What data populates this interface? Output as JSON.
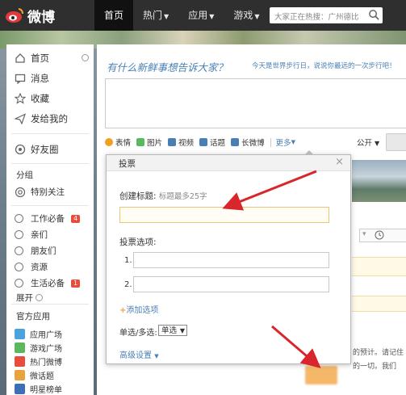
{
  "topbar": {
    "logo_text": "微博",
    "nav": [
      {
        "label": "首页",
        "active": true,
        "caret": false
      },
      {
        "label": "热门",
        "active": false,
        "caret": true
      },
      {
        "label": "应用",
        "active": false,
        "caret": true
      },
      {
        "label": "游戏",
        "active": false,
        "caret": true
      }
    ],
    "search_placeholder": "大家正在热搜：广州德比"
  },
  "sidebar": {
    "items": [
      {
        "label": "首页",
        "icon": "home-icon"
      },
      {
        "label": "消息",
        "icon": "message-icon"
      },
      {
        "label": "收藏",
        "icon": "star-icon"
      },
      {
        "label": "发给我的",
        "icon": "send-icon"
      }
    ],
    "friends": "好友圈",
    "group_heading": "分组",
    "special": "特别关注",
    "groups": [
      {
        "label": "工作必备",
        "badge": "4"
      },
      {
        "label": "亲们",
        "badge": ""
      },
      {
        "label": "朋友们",
        "badge": ""
      },
      {
        "label": "资源",
        "badge": ""
      },
      {
        "label": "生活必备",
        "badge": "1"
      }
    ],
    "expand": "展开",
    "apps_heading": "官方应用",
    "apps": [
      {
        "label": "应用广场",
        "color": "#4aa3df"
      },
      {
        "label": "游戏广场",
        "color": "#5cb85c"
      },
      {
        "label": "热门微博",
        "color": "#e74c3c"
      },
      {
        "label": "微话题",
        "color": "#e8a33d"
      },
      {
        "label": "明星榜单",
        "color": "#3b6fb6"
      }
    ]
  },
  "main": {
    "prompt": "有什么新鲜事想告诉大家？",
    "hint": "今天是世界步行日，说说你最远的一次步行吧！",
    "toolbar": [
      {
        "label": "表情",
        "icon": "smile-icon",
        "color": "#f0a020"
      },
      {
        "label": "图片",
        "icon": "image-icon",
        "color": "#5cb85c"
      },
      {
        "label": "视频",
        "icon": "video-icon",
        "color": "#4a7fb5"
      },
      {
        "label": "话题",
        "icon": "topic-icon",
        "color": "#4a7fb5"
      },
      {
        "label": "长微博",
        "icon": "longpost-icon",
        "color": "#4a7fb5"
      }
    ],
    "more": "更多",
    "visibility": "公开"
  },
  "dialog": {
    "title": "投票",
    "title_label": "创建标题:",
    "title_hint": "标题最多25字",
    "options_label": "投票选项:",
    "option_numbers": [
      "1.",
      "2."
    ],
    "add_option": "添加选项",
    "mode_label": "单选/多选:",
    "mode_value": "单选",
    "advanced": "高级设置"
  },
  "background": {
    "clock_label": "",
    "peek_line1": "的预计。请记住",
    "peek_line2": "的一切。我们"
  },
  "colors": {
    "accent_blue": "#4a7fb5",
    "input_highlight": "#e8c676",
    "arrow_red": "#d9262c"
  }
}
